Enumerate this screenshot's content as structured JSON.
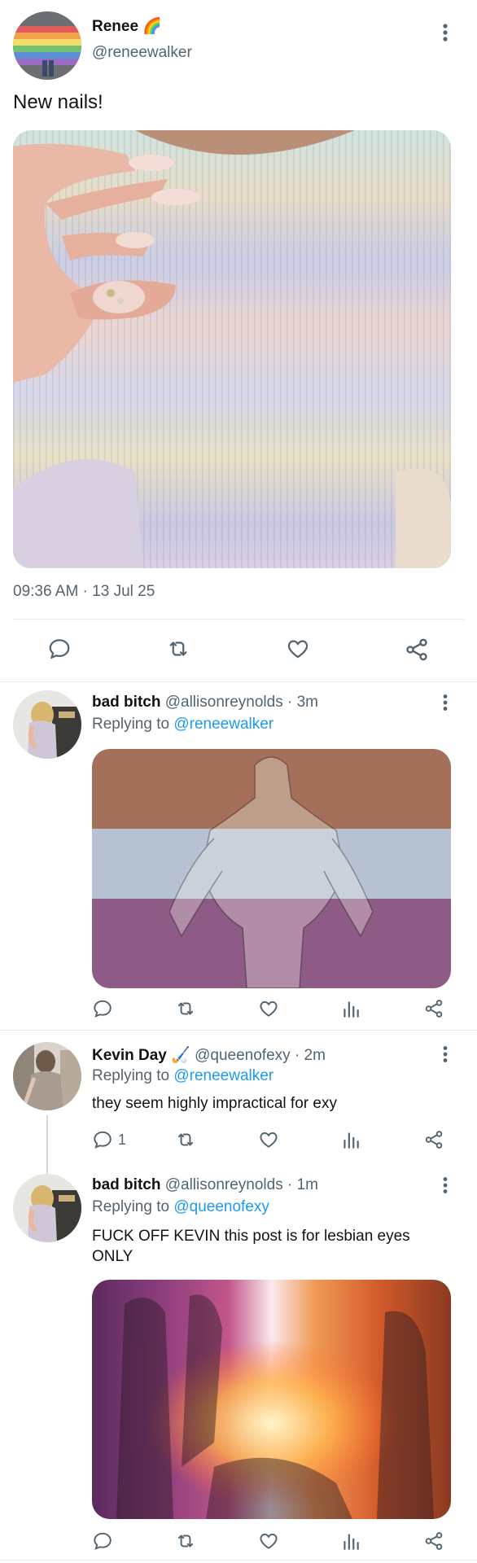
{
  "main_tweet": {
    "name": "Renee",
    "name_emoji": "🌈",
    "handle": "@reneewalker",
    "text": "New nails!",
    "timestamp": "09:36 AM · 13 Jul 25"
  },
  "replies": [
    {
      "name": "bad bitch",
      "handle": "@allisonreynolds",
      "time": "· 3m",
      "replying_label": "Replying to",
      "replying_to": "@reneewalker",
      "text": "",
      "reply_count": ""
    },
    {
      "name": "Kevin Day",
      "name_emoji": "🏑",
      "handle": "@queenofexy",
      "time": "· 2m",
      "replying_label": "Replying to",
      "replying_to": "@reneewalker",
      "text": "they seem highly impractical for exy",
      "reply_count": "1"
    },
    {
      "name": "bad bitch",
      "handle": "@allisonreynolds",
      "time": "· 1m",
      "replying_label": "Replying to",
      "replying_to": "@queenofexy",
      "text_line1": "FUCK OFF KEVIN this post is for lesbian eyes",
      "text_line2": "ONLY",
      "reply_count": ""
    }
  ],
  "colors": {
    "accent": "#1d9bf0",
    "secondary_text": "#536471",
    "divider": "#e6ecf0",
    "flag_brown": "#a4705a",
    "flag_grey": "#b6c2d2",
    "flag_purple": "#8e5a86"
  },
  "icons": [
    "more-vertical-icon",
    "reply-icon",
    "retweet-icon",
    "like-icon",
    "share-icon",
    "views-icon"
  ]
}
